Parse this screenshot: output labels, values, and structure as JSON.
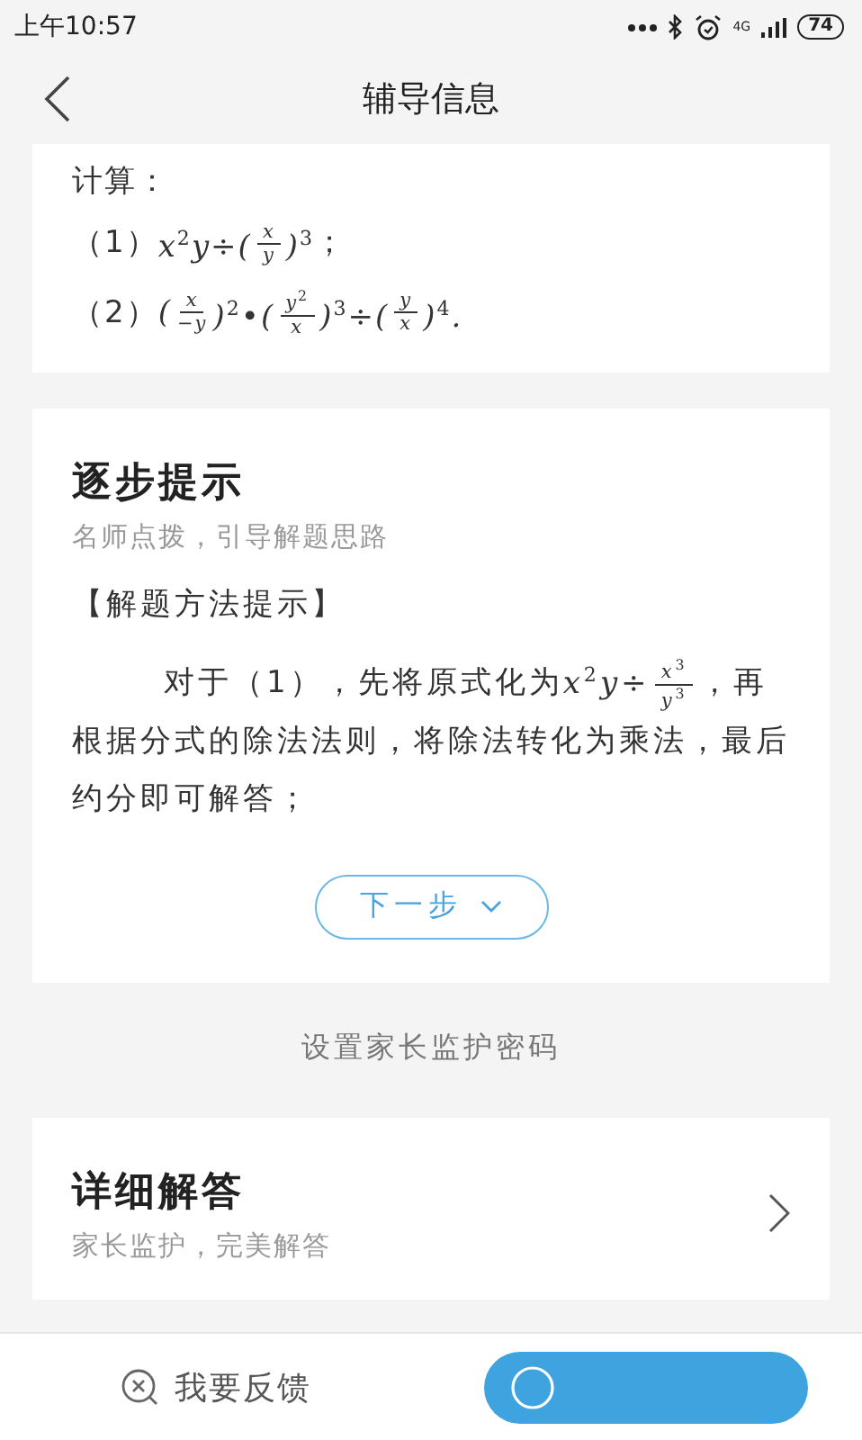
{
  "status_bar": {
    "time": "上午10:57",
    "network": "4G",
    "battery": "74"
  },
  "header": {
    "title": "辅导信息"
  },
  "question": {
    "label": "计算：",
    "lines": [
      [
        {
          "kind": "text",
          "text": "（1）"
        },
        {
          "kind": "math",
          "text": "x$^{2}$y÷("
        },
        {
          "kind": "frac",
          "num": "x",
          "den": "y"
        },
        {
          "kind": "math",
          "text": ")$^{3}$"
        },
        {
          "kind": "text",
          "text": "；"
        }
      ],
      [
        {
          "kind": "text",
          "text": "（2）"
        },
        {
          "kind": "math",
          "text": "("
        },
        {
          "kind": "frac",
          "num": "x",
          "den": "−y"
        },
        {
          "kind": "math",
          "text": ")$^{2}$•("
        },
        {
          "kind": "frac",
          "num": "y$^{2}$",
          "den": "x"
        },
        {
          "kind": "math",
          "text": ")$^{3}$÷("
        },
        {
          "kind": "frac",
          "num": "y",
          "den": "x"
        },
        {
          "kind": "math",
          "text": ")$^{4}$."
        }
      ]
    ]
  },
  "hints": {
    "title": "逐步提示",
    "subtitle": "名师点拨，引导解题思路",
    "section": "【解题方法提示】",
    "paragraph": [
      {
        "kind": "text",
        "text": "对于（1），先将原式化为"
      },
      {
        "kind": "math",
        "text": "x$^{2}$y÷"
      },
      {
        "kind": "frac",
        "num": "x$^{3}$",
        "den": "y$^{3}$"
      },
      {
        "kind": "text",
        "text": "，再根据分式的除法法则，将除法转化为乘法，最后约分即可解答；"
      }
    ],
    "next_button": "下一步"
  },
  "parent_lock_link": "设置家长监护密码",
  "answer": {
    "title": "详细解答",
    "subtitle": "家长监护，完美解答"
  },
  "bottom_bar": {
    "feedback": "我要反馈"
  }
}
